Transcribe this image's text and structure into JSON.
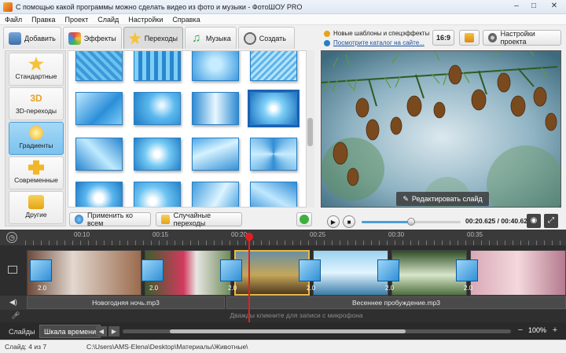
{
  "window": {
    "title": "С помощью какой программы можно сделать видео из фото и музыки - ФотоШОУ PRO",
    "minimize": "–",
    "maximize": "□",
    "close": "✕"
  },
  "menu": [
    "Файл",
    "Правка",
    "Проект",
    "Слайд",
    "Настройки",
    "Справка"
  ],
  "tabs": [
    {
      "label": "Добавить",
      "icon": "camera-icon"
    },
    {
      "label": "Эффекты",
      "icon": "palette-icon"
    },
    {
      "label": "Переходы",
      "icon": "star-icon",
      "active": true
    },
    {
      "label": "Музыка",
      "icon": "music-note-icon"
    },
    {
      "label": "Создать",
      "icon": "film-reel-icon"
    }
  ],
  "categories": [
    {
      "label": "Стандартные",
      "icon": "star-icon"
    },
    {
      "label": "3D-переходы",
      "icon": "3d-icon",
      "glyph": "3D"
    },
    {
      "label": "Градиенты",
      "icon": "gradient-icon",
      "active": true
    },
    {
      "label": "Современные",
      "icon": "puzzle-icon"
    },
    {
      "label": "Другие",
      "icon": "box-icon"
    }
  ],
  "left_buttons": {
    "apply_all": "Применить ко всем",
    "random": "Случайные переходы"
  },
  "info": {
    "news": "Новые шаблоны и спецэффекты",
    "catalog_link": "Посмотрите каталог на сайте...",
    "aspect": "16:9",
    "settings": "Настройки проекта"
  },
  "preview": {
    "edit_slide": "Редактировать слайд",
    "time": "00:20.625 / 00:40.625",
    "progress": 0.5
  },
  "timeline": {
    "ticks": [
      "00:10",
      "00:15",
      "00:20",
      "00:25",
      "00:30",
      "00:35"
    ],
    "slide_durations": [
      "2.0",
      "2.0",
      "2.0",
      "2.0",
      "2.0",
      "2.0"
    ],
    "audio": [
      "Новогодняя ночь.mp3",
      "Весеннее пробуждение.mp3"
    ],
    "mic_hint": "Дважды кликните для записи с микрофона"
  },
  "bottom": {
    "tab_slides": "Слайды",
    "tab_timeline": "Шкала времени",
    "zoom": "100%",
    "minus": "−",
    "plus": "+"
  },
  "status": {
    "slide": "Слайд: 4 из 7",
    "path": "C:\\Users\\AMS-Elena\\Desktop\\Материалы\\Животные\\"
  },
  "colors": {
    "accent": "#2a7fc2",
    "selected_category": "#7bc2ee",
    "playhead": "#e02020"
  }
}
